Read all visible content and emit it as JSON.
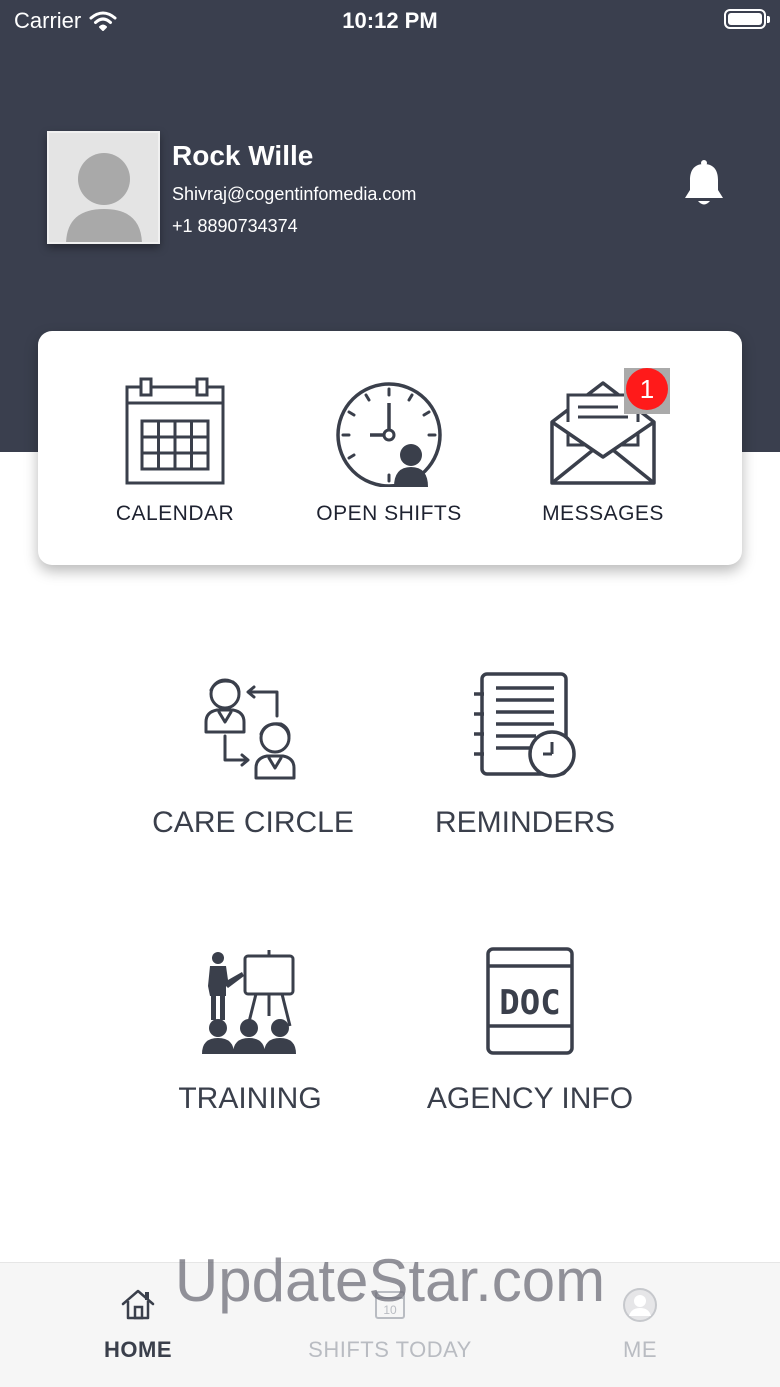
{
  "status_bar": {
    "carrier": "Carrier",
    "time": "10:12 PM"
  },
  "profile": {
    "name": "Rock Wille",
    "email": "Shivraj@cogentinfomedia.com",
    "phone": "+1 8890734374"
  },
  "quick_actions": [
    {
      "label": "CALENDAR",
      "icon": "calendar-icon"
    },
    {
      "label": "OPEN SHIFTS",
      "icon": "clock-user-icon"
    },
    {
      "label": "MESSAGES",
      "icon": "envelope-icon",
      "badge": "1"
    }
  ],
  "menu": [
    {
      "label": "CARE CIRCLE",
      "icon": "care-circle-icon"
    },
    {
      "label": "REMINDERS",
      "icon": "reminders-icon"
    },
    {
      "label": "TRAINING",
      "icon": "training-icon"
    },
    {
      "label": "AGENCY INFO",
      "icon": "document-icon",
      "icon_text": "DOC"
    }
  ],
  "tabbar": [
    {
      "label": "HOME",
      "icon": "home-icon",
      "active": true
    },
    {
      "label": "SHIFTS TODAY",
      "icon": "calendar-day-icon",
      "icon_text": "10",
      "active": false
    },
    {
      "label": "ME",
      "icon": "user-circle-icon",
      "active": false
    }
  ],
  "watermark": "UpdateStar.com",
  "colors": {
    "header": "#3a3f4e",
    "badge": "#ff1a1a",
    "tab_active": "#3a3f4b",
    "tab_inactive": "#b9bcc2"
  }
}
